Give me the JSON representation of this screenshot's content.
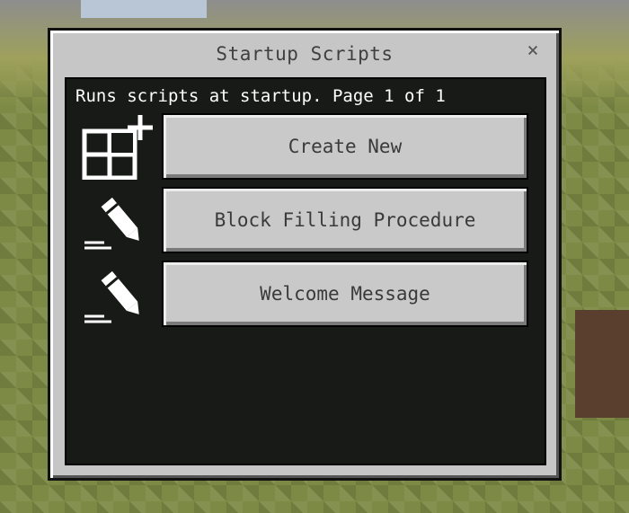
{
  "dialog": {
    "title": "Startup Scripts",
    "close_label": "×",
    "subtitle": "Runs scripts at startup. Page 1 of 1"
  },
  "rows": [
    {
      "label": "Create New",
      "icon": "create-new-icon"
    },
    {
      "label": "Block Filling Procedure",
      "icon": "edit-pencil-icon"
    },
    {
      "label": "Welcome Message",
      "icon": "edit-pencil-icon"
    }
  ]
}
